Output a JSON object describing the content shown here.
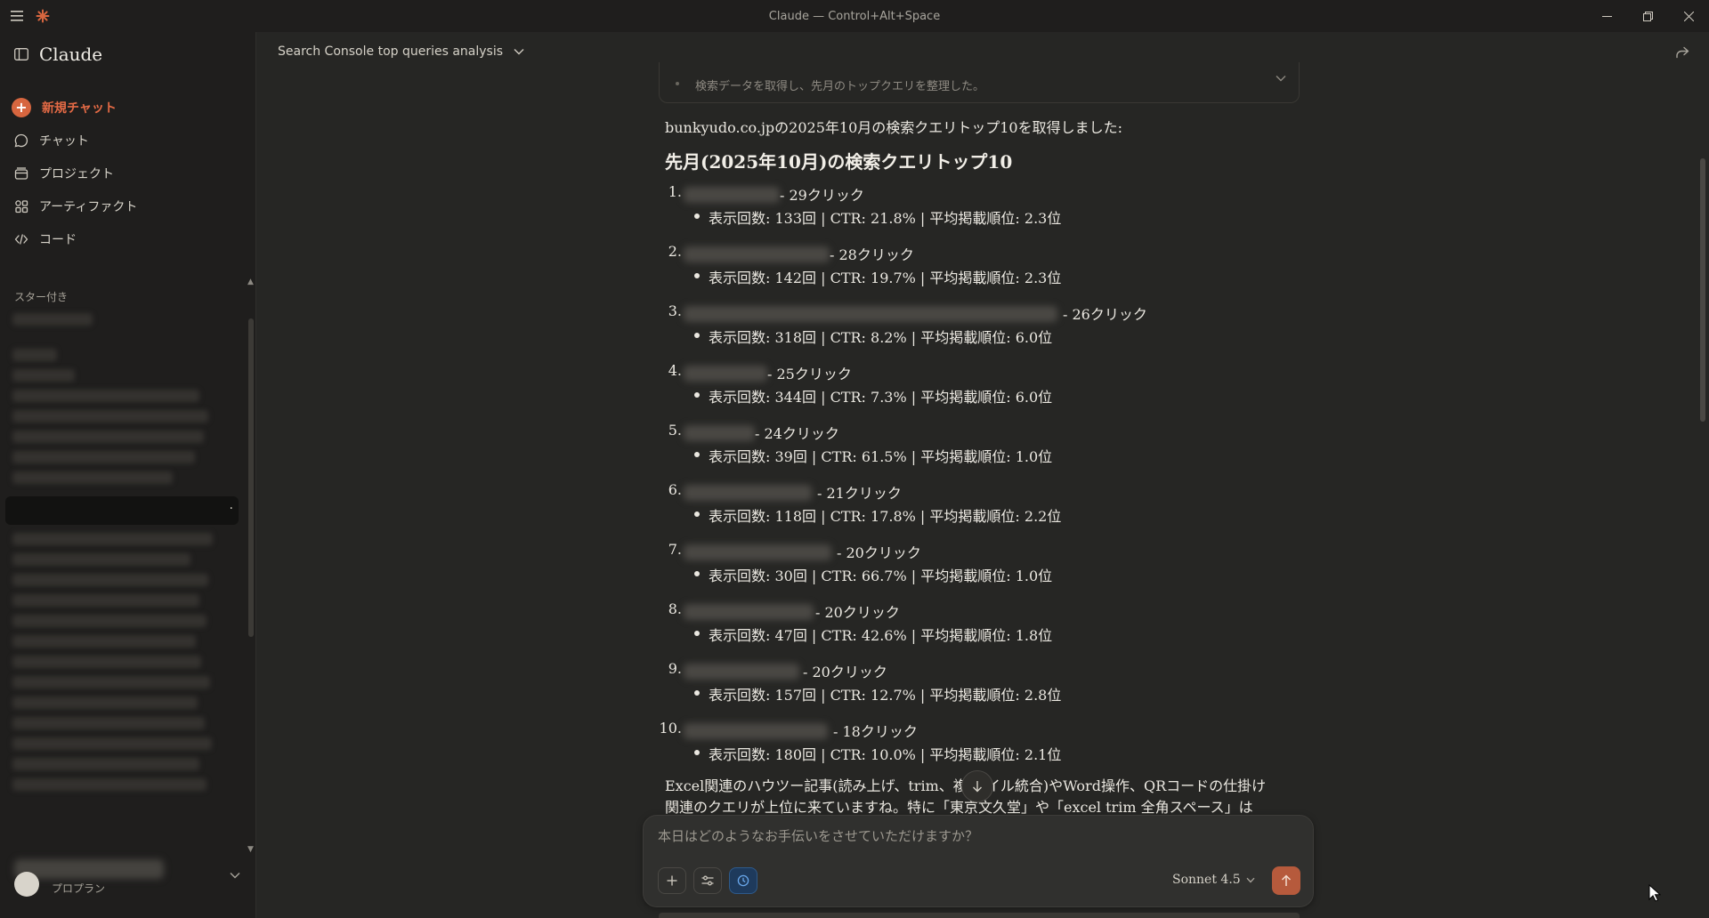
{
  "window": {
    "title": "Claude — Control+Alt+Space"
  },
  "sidebar": {
    "brand": "Claude",
    "nav": [
      {
        "label": "新規チャット",
        "icon": "plus-icon"
      },
      {
        "label": "チャット",
        "icon": "chat-bubble-icon"
      },
      {
        "label": "プロジェクト",
        "icon": "folder-icon"
      },
      {
        "label": "アーティファクト",
        "icon": "artifacts-icon"
      },
      {
        "label": "コード",
        "icon": "code-icon"
      }
    ],
    "starred_label": "スター付き",
    "plan_label": "プロプラン"
  },
  "chat": {
    "title": "Search Console top queries analysis",
    "tool_summary": "検索データを取得し、先月のトップクエリを整理した。",
    "intro": "bunkyudo.co.jpの2025年10月の検索クエリトップ10を取得しました:",
    "heading": "先月(2025年10月)の検索クエリトップ10",
    "queries": [
      {
        "num": "1.",
        "clicks": "- 29クリック",
        "detail": "表示回数: 133回 | CTR: 21.8% | 平均掲載順位: 2.3位"
      },
      {
        "num": "2.",
        "clicks": "- 28クリック",
        "detail": "表示回数: 142回 | CTR: 19.7% | 平均掲載順位: 2.3位"
      },
      {
        "num": "3.",
        "clicks": "- 26クリック",
        "detail": "表示回数: 318回 | CTR: 8.2% | 平均掲載順位: 6.0位"
      },
      {
        "num": "4.",
        "clicks": "- 25クリック",
        "detail": "表示回数: 344回 | CTR: 7.3% | 平均掲載順位: 6.0位"
      },
      {
        "num": "5.",
        "clicks": "- 24クリック",
        "detail": "表示回数: 39回 | CTR: 61.5% | 平均掲載順位: 1.0位"
      },
      {
        "num": "6.",
        "clicks": "- 21クリック",
        "detail": "表示回数: 118回 | CTR: 17.8% | 平均掲載順位: 2.2位"
      },
      {
        "num": "7.",
        "clicks": "- 20クリック",
        "detail": "表示回数: 30回 | CTR: 66.7% | 平均掲載順位: 1.0位"
      },
      {
        "num": "8.",
        "clicks": "- 20クリック",
        "detail": "表示回数: 47回 | CTR: 42.6% | 平均掲載順位: 1.8位"
      },
      {
        "num": "9.",
        "clicks": "- 20クリック",
        "detail": "表示回数: 157回 | CTR: 12.7% | 平均掲載順位: 2.8位"
      },
      {
        "num": "10.",
        "clicks": "- 18クリック",
        "detail": "表示回数: 180回 | CTR: 10.0% | 平均掲載順位: 2.1位"
      }
    ],
    "paragraph": "Excel関連のハウツー記事(読み上げ、trim、複 ァイル統合)やWord操作、QRコードの仕掛け関連のクエリが上位に来ていますね。特に「東京文久堂」や「excel trim 全角スペース」は"
  },
  "composer": {
    "placeholder": "本日はどのようなお手伝いをさせていただけますか？",
    "model": "Sonnet 4.5"
  },
  "colors": {
    "accent": "#d7663f",
    "background": "#262624",
    "sidebar": "#1f1e1d"
  }
}
